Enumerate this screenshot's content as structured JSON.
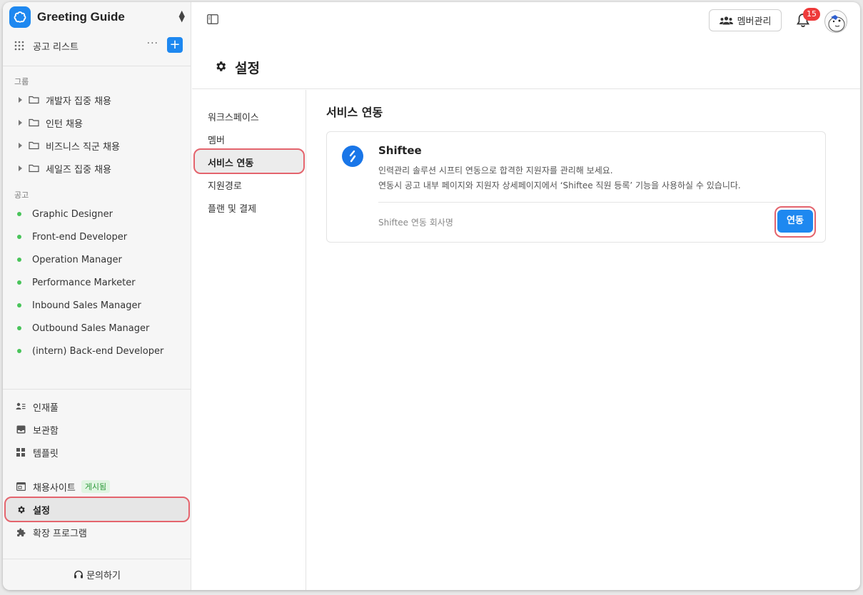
{
  "app": {
    "name": "Greeting Guide",
    "brand_color": "#1e88f0"
  },
  "sidebar": {
    "job_list_label": "공고 리스트",
    "more_label": "···",
    "add_label": "+",
    "groups_title": "그룹",
    "groups": [
      {
        "label": "개발자 집중 채용"
      },
      {
        "label": "인턴 채용"
      },
      {
        "label": "비즈니스 직군 채용"
      },
      {
        "label": "세일즈 집중 채용"
      }
    ],
    "jobs_title": "공고",
    "jobs": [
      {
        "label": "Graphic Designer"
      },
      {
        "label": "Front-end Developer"
      },
      {
        "label": "Operation Manager"
      },
      {
        "label": "Performance Marketer"
      },
      {
        "label": "Inbound Sales Manager"
      },
      {
        "label": "Outbound Sales Manager"
      },
      {
        "label": "(intern) Back-end Developer"
      }
    ],
    "nav": {
      "talent_pool": "인재풀",
      "archive": "보관함",
      "templates": "템플릿",
      "career_site": "채용사이트",
      "career_site_badge": "게시됨",
      "settings": "설정",
      "extensions": "확장 프로그램"
    },
    "help_label": "문의하기"
  },
  "topbar": {
    "member_manage_label": "멤버관리",
    "notification_count": "15"
  },
  "page": {
    "title": "설정"
  },
  "settings_nav": {
    "items": [
      {
        "label": "워크스페이스"
      },
      {
        "label": "멤버"
      },
      {
        "label": "서비스 연동"
      },
      {
        "label": "지원경로"
      },
      {
        "label": "플랜 및 결제"
      }
    ],
    "active": "서비스 연동"
  },
  "content": {
    "title": "서비스 연동",
    "integration": {
      "name": "Shiftee",
      "description_line1": "인력관리 솔루션 시프티 연동으로 합격한 지원자를 관리해 보세요.",
      "description_line2": "연동시 공고 내부 페이지와 지원자 상세페이지에서 ‘Shiftee 직원 등록’ 기능을 사용하실 수 있습니다.",
      "company_field_label": "Shiftee 연동 회사명",
      "connect_label": "연동"
    }
  }
}
